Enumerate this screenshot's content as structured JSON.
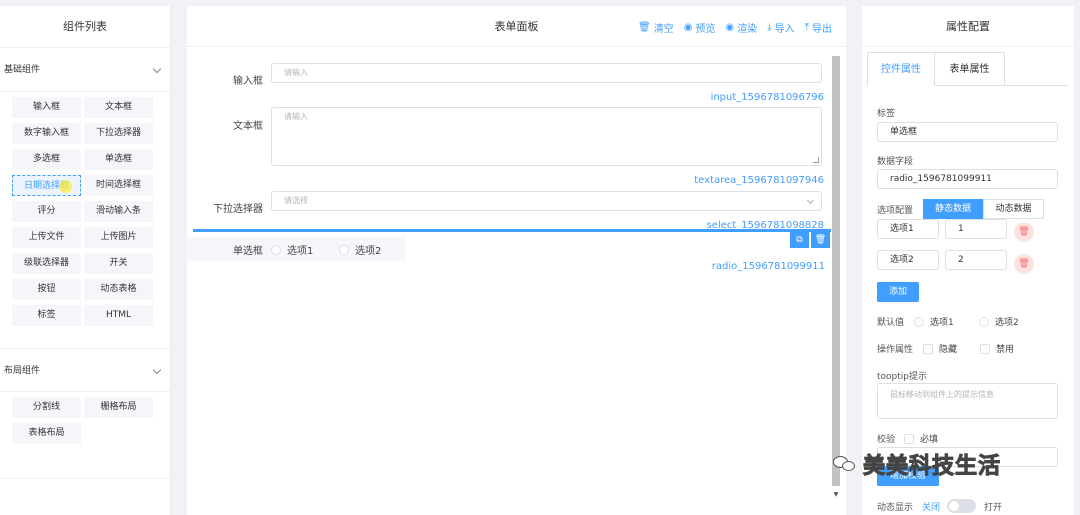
{
  "left_panel": {
    "title": "组件列表",
    "basic_group": {
      "title": "基础组件",
      "items": [
        "输入框",
        "文本框",
        "数字输入框",
        "下拉选择器",
        "多选框",
        "单选框",
        "日期选择框",
        "时间选择框",
        "评分",
        "滑动输入条",
        "上传文件",
        "上传图片",
        "级联选择器",
        "开关",
        "按钮",
        "动态表格",
        "标签",
        "HTML"
      ],
      "hovered_item": "日期选择框"
    },
    "layout_group": {
      "title": "布局组件",
      "items": [
        "分割线",
        "栅格布局",
        "表格布局"
      ]
    }
  },
  "center_panel": {
    "title": "表单面板",
    "toolbar": [
      {
        "label": "清空",
        "icon": "trash-icon"
      },
      {
        "label": "预览",
        "icon": "eye-icon"
      },
      {
        "label": "渲染",
        "icon": "eye-icon"
      },
      {
        "label": "导入",
        "icon": "download-icon"
      },
      {
        "label": "导出",
        "icon": "upload-icon"
      }
    ],
    "fields": {
      "input": {
        "label": "输入框",
        "placeholder": "请输入",
        "id": "input_1596781096796"
      },
      "textarea": {
        "label": "文本框",
        "placeholder": "请输入",
        "id": "textarea_1596781097946"
      },
      "select": {
        "label": "下拉选择器",
        "placeholder": "请选择",
        "id": "select_1596781098828"
      },
      "radio": {
        "label": "单选框",
        "options": [
          "选项1",
          "选项2"
        ],
        "id": "radio_1596781099911"
      }
    }
  },
  "right_panel": {
    "title": "属性配置",
    "tabs": [
      "控件属性",
      "表单属性"
    ],
    "active_tab": "控件属性",
    "label_field": {
      "label": "标签",
      "value": "单选框"
    },
    "data_field": {
      "label": "数据字段",
      "value": "radio_1596781099911"
    },
    "options_config": {
      "label": "选项配置",
      "modes": [
        "静态数据",
        "动态数据"
      ],
      "active_mode": "静态数据",
      "rows": [
        {
          "label": "选项1",
          "value": "1"
        },
        {
          "label": "选项2",
          "value": "2"
        }
      ],
      "add_label": "添加"
    },
    "default_value": {
      "label": "默认值",
      "options": [
        "选项1",
        "选项2"
      ]
    },
    "operation_attrs": {
      "label": "操作属性",
      "options": [
        "隐藏",
        "禁用"
      ]
    },
    "tooltip": {
      "label": "tooptip提示",
      "placeholder": "鼠标移动到组件上的提示信息"
    },
    "validation": {
      "label": "校验",
      "required_label": "必填",
      "add_rule_label": "增加校验"
    },
    "dynamic_display": {
      "label": "动态显示",
      "off_label": "关闭",
      "on_label": "打开"
    }
  },
  "watermark": {
    "text": "美美科技生活"
  },
  "colors": {
    "primary": "#409eff",
    "danger": "#f56c6c",
    "border": "#dcdfe6",
    "background": "#f0f2f5"
  }
}
